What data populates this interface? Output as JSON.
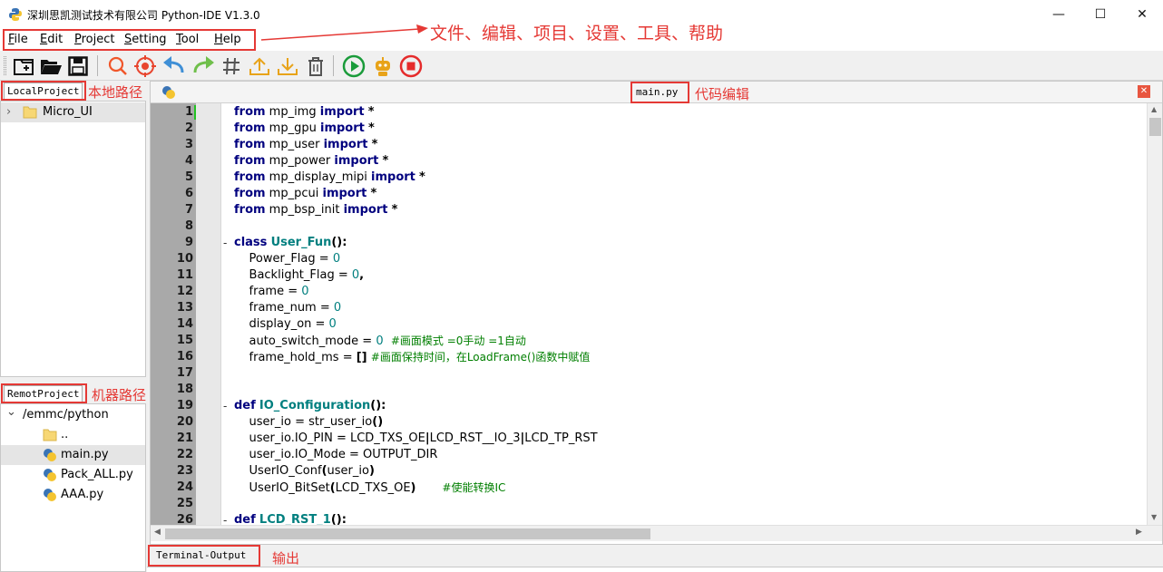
{
  "window": {
    "title": "深圳思凯测试技术有限公司  Python-IDE  V1.3.0",
    "minimize": "—",
    "maximize": "☐",
    "close": "✕"
  },
  "menu": {
    "items": [
      {
        "first": "F",
        "rest": "ile"
      },
      {
        "first": "E",
        "rest": "dit"
      },
      {
        "first": "P",
        "rest": "roject"
      },
      {
        "first": "S",
        "rest": "etting"
      },
      {
        "first": "T",
        "rest": "ool"
      },
      {
        "first": "H",
        "rest": "elp"
      }
    ],
    "annotation": "文件、编辑、项目、设置、工具、帮助"
  },
  "toolbar": {
    "icons": [
      "new-project-icon",
      "open-folder-icon",
      "save-icon",
      "search-icon",
      "target-icon",
      "undo-icon",
      "redo-icon",
      "hash-comment-icon",
      "upload-icon",
      "download-icon",
      "delete-icon",
      "run-icon",
      "robot-icon",
      "stop-icon"
    ]
  },
  "local_project": {
    "tab": "LocalProject",
    "annotation": "本地路径",
    "items": [
      {
        "label": "Micro_UI",
        "expander": "›"
      }
    ]
  },
  "remote_project": {
    "tab": "RemotProject",
    "annotation": "机器路径",
    "root": "/emmc/python",
    "root_expander": "⌄",
    "items": [
      {
        "label": ".."
      },
      {
        "label": "main.py"
      },
      {
        "label": "Pack_ALL.py"
      },
      {
        "label": "AAA.py"
      }
    ]
  },
  "editor": {
    "file_tab": "main.py",
    "annotation": "代码编辑",
    "close_icon": "✕",
    "lines": [
      {
        "n": "1",
        "html": "<span class='kw'>from</span> mp_img <span class='kw'>import</span> <span class='op'>*</span>"
      },
      {
        "n": "2",
        "html": "<span class='kw'>from</span> mp_gpu <span class='kw'>import</span> <span class='op'>*</span>"
      },
      {
        "n": "3",
        "html": "<span class='kw'>from</span> mp_user <span class='kw'>import</span> <span class='op'>*</span>"
      },
      {
        "n": "4",
        "html": "<span class='kw'>from</span> mp_power <span class='kw'>import</span> <span class='op'>*</span>"
      },
      {
        "n": "5",
        "html": "<span class='kw'>from</span> mp_display_mipi <span class='kw'>import</span> <span class='op'>*</span>"
      },
      {
        "n": "6",
        "html": "<span class='kw'>from</span> mp_pcui <span class='kw'>import</span> <span class='op'>*</span>"
      },
      {
        "n": "7",
        "html": "<span class='kw'>from</span> mp_bsp_init <span class='kw'>import</span> <span class='op'>*</span>"
      },
      {
        "n": "8",
        "html": ""
      },
      {
        "n": "9",
        "fold": "-",
        "html": "<span class='kw'>class</span> <span class='nm'>User_Fun</span><span class='op'>():</span>"
      },
      {
        "n": "10",
        "html": "    Power_Flag = <span class='num'>0</span>"
      },
      {
        "n": "11",
        "html": "    Backlight_Flag = <span class='num'>0</span><span class='op'>,</span>"
      },
      {
        "n": "12",
        "html": "    frame = <span class='num'>0</span>"
      },
      {
        "n": "13",
        "html": "    frame_num = <span class='num'>0</span>"
      },
      {
        "n": "14",
        "html": "    display_on = <span class='num'>0</span>"
      },
      {
        "n": "15",
        "html": "    auto_switch_mode = <span class='num'>0</span>  <span class='cm'>#画面模式 =0手动 =1自动</span>"
      },
      {
        "n": "16",
        "html": "    frame_hold_ms = <span class='op'>[]</span> <span class='cm'>#画面保持时间，在LoadFrame()函数中赋值</span>"
      },
      {
        "n": "17",
        "html": ""
      },
      {
        "n": "18",
        "html": ""
      },
      {
        "n": "19",
        "fold": "-",
        "html": "<span class='kw'>def</span> <span class='nm'>IO_Configuration</span><span class='op'>():</span>"
      },
      {
        "n": "20",
        "html": "    user_io = str_user_io<span class='op'>()</span>"
      },
      {
        "n": "21",
        "html": "    user_io.IO_PIN = LCD_TXS_OE<span class='op'>|</span>LCD_RST__IO_3<span class='op'>|</span>LCD_TP_RST"
      },
      {
        "n": "22",
        "html": "    user_io.IO_Mode = OUTPUT_DIR"
      },
      {
        "n": "23",
        "html": "    UserIO_Conf<span class='op'>(</span>user_io<span class='op'>)</span>"
      },
      {
        "n": "24",
        "html": "    UserIO_BitSet<span class='op'>(</span>LCD_TXS_OE<span class='op'>)</span>       <span class='cm'>#使能转换IC</span>"
      },
      {
        "n": "25",
        "html": ""
      },
      {
        "n": "26",
        "fold": "-",
        "html": "<span class='kw'>def</span> <span class='nm'>LCD_RST_1</span><span class='op'>():</span>"
      }
    ]
  },
  "terminal": {
    "tab": "Terminal-Output",
    "annotation": "输出"
  }
}
